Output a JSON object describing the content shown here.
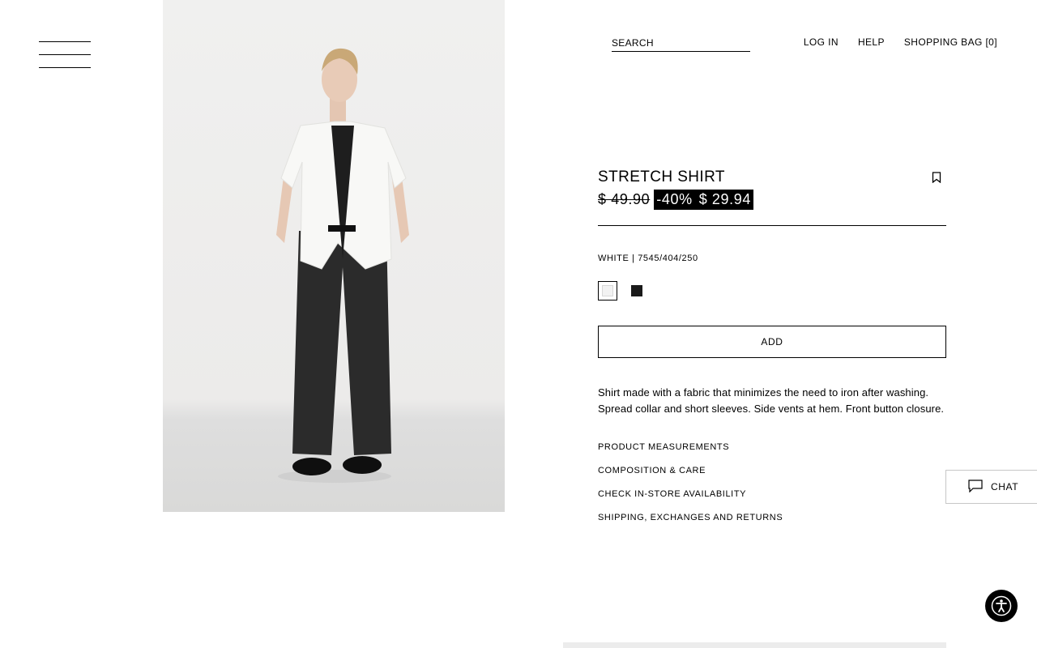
{
  "header": {
    "search_placeholder": "SEARCH",
    "nav": {
      "login": "LOG IN",
      "help": "HELP",
      "bag": "SHOPPING BAG [0]"
    }
  },
  "product": {
    "title": "STRETCH SHIRT",
    "old_price": "$ 49.90",
    "discount": "-40%",
    "sale_price": "$ 29.94",
    "color_ref": "WHITE | 7545/404/250",
    "colors": [
      {
        "name": "white",
        "hex": "#f2f2f2",
        "selected": true
      },
      {
        "name": "black",
        "hex": "#1a1a1a",
        "selected": false
      }
    ],
    "add_label": "ADD",
    "description": "Shirt made with a fabric that minimizes the need to iron after washing. Spread collar and short sleeves. Side vents at hem. Front button closure.",
    "links": [
      "PRODUCT MEASUREMENTS",
      "COMPOSITION & CARE",
      "CHECK IN-STORE AVAILABILITY",
      "SHIPPING, EXCHANGES AND RETURNS"
    ]
  },
  "chat": {
    "label": "CHAT"
  },
  "icons": {
    "menu": "hamburger-menu-icon",
    "bookmark": "bookmark-icon",
    "chat": "chat-bubble-icon",
    "accessibility": "accessibility-icon"
  },
  "colors": {
    "text": "#000000",
    "background": "#ffffff",
    "sale_bg": "#000000",
    "sale_text": "#ffffff"
  }
}
